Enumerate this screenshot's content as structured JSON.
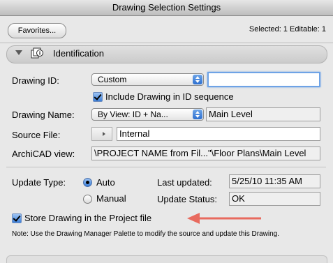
{
  "window": {
    "title": "Drawing Selection Settings"
  },
  "toolbar": {
    "favorites_label": "Favorites...",
    "selection_info": "Selected: 1 Editable: 1"
  },
  "section": {
    "title": "Identification",
    "icon": "drawing-info-icon"
  },
  "drawing_id": {
    "label": "Drawing ID:",
    "mode": "Custom",
    "value": ""
  },
  "include_sequence": {
    "label": "Include Drawing in ID sequence",
    "checked": true
  },
  "drawing_name": {
    "label": "Drawing Name:",
    "mode": "By View: ID + Na...",
    "value": "Main Level"
  },
  "source_file": {
    "label": "Source File:",
    "value": "Internal"
  },
  "archicad_view": {
    "label": "ArchiCAD view:",
    "value": "\\PROJECT NAME from Fil...\"\\Floor Plans\\Main Level"
  },
  "update": {
    "type_label": "Update Type:",
    "auto_label": "Auto",
    "manual_label": "Manual",
    "selected": "Auto",
    "last_updated_label": "Last updated:",
    "last_updated_value": "5/25/10 11:35 AM",
    "status_label": "Update Status:",
    "status_value": "OK"
  },
  "store_drawing": {
    "label": "Store Drawing in the Project file",
    "checked": true
  },
  "note": {
    "text": "Note:  Use the Drawing Manager Palette to modify the source and update this Drawing."
  },
  "colors": {
    "accent": "#3d7fd8",
    "annotation_arrow": "#e86a5e"
  }
}
